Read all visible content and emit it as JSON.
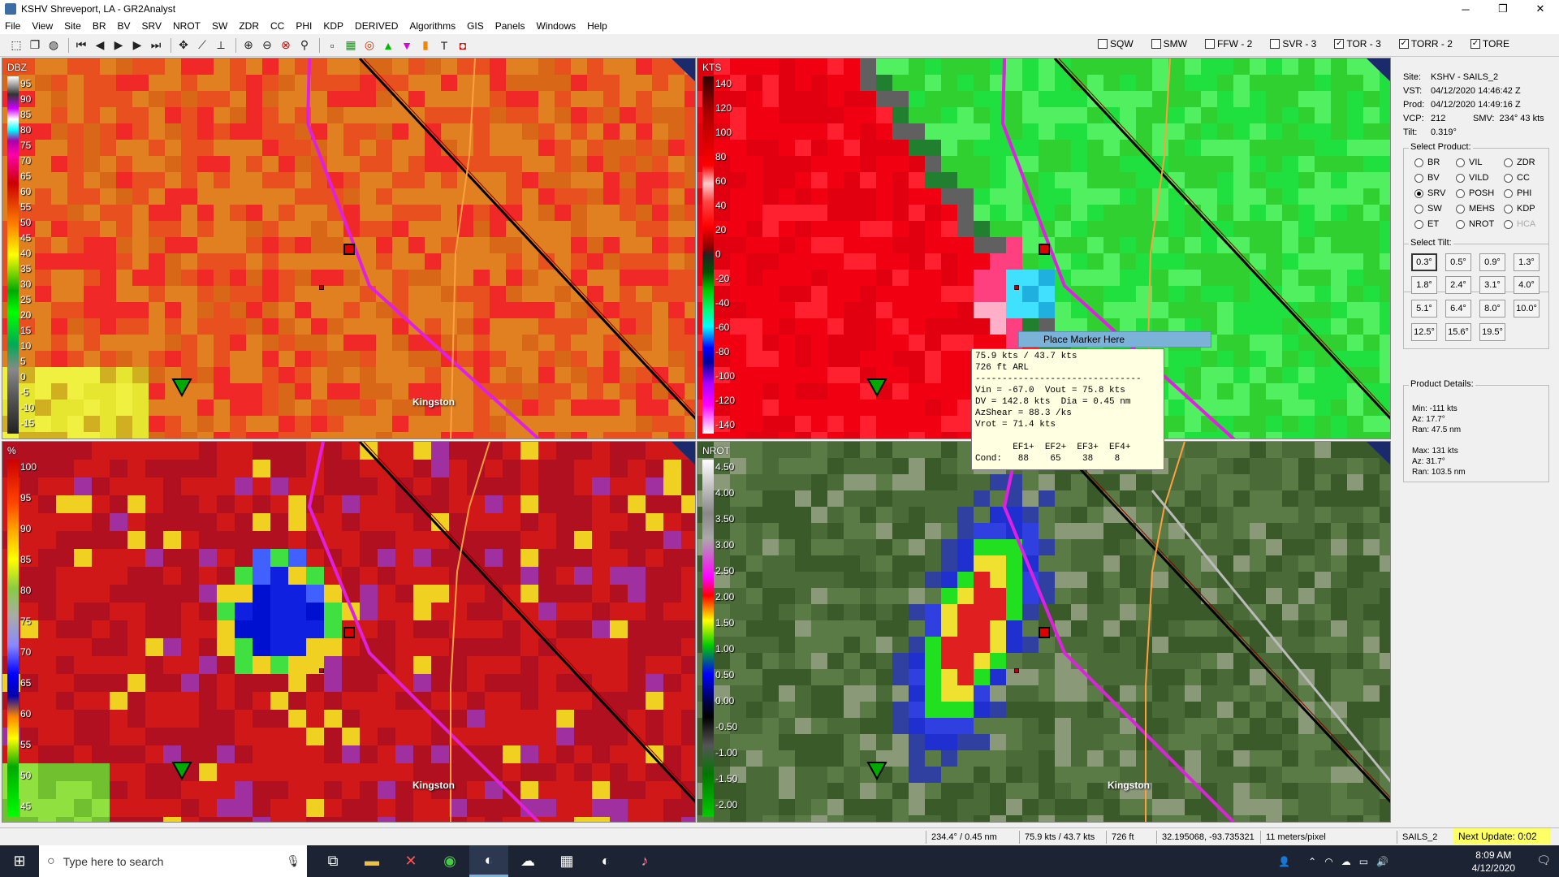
{
  "window": {
    "title": "KSHV Shreveport, LA - GR2Analyst",
    "min": "─",
    "max": "❐",
    "close": "✕"
  },
  "menu": [
    "File",
    "View",
    "Site",
    "BR",
    "BV",
    "SRV",
    "NROT",
    "SW",
    "ZDR",
    "CC",
    "PHI",
    "KDP",
    "DERIVED",
    "Algorithms",
    "GIS",
    "Panels",
    "Windows",
    "Help"
  ],
  "warnings": [
    {
      "label": "SQW",
      "checked": false
    },
    {
      "label": "SMW",
      "checked": false
    },
    {
      "label": "FFW - 2",
      "checked": false
    },
    {
      "label": "SVR - 3",
      "checked": false
    },
    {
      "label": "TOR - 3",
      "checked": true
    },
    {
      "label": "TORR - 2",
      "checked": true
    },
    {
      "label": "TORE",
      "checked": true
    }
  ],
  "panels": {
    "p1": {
      "unit": "DBZ",
      "ticks": [
        "95",
        "90",
        "85",
        "80",
        "75",
        "70",
        "65",
        "60",
        "55",
        "50",
        "45",
        "40",
        "35",
        "30",
        "25",
        "20",
        "15",
        "10",
        "5",
        "0",
        "-5",
        "-10",
        "-15"
      ],
      "town": "Kingston"
    },
    "p2": {
      "unit": "KTS",
      "ticks": [
        "140",
        "120",
        "100",
        "80",
        "60",
        "40",
        "20",
        "0",
        "-20",
        "-40",
        "-60",
        "-80",
        "-100",
        "-120",
        "-140"
      ],
      "town": "Kingston"
    },
    "p3": {
      "unit": "%",
      "ticks": [
        "100",
        "95",
        "90",
        "85",
        "80",
        "75",
        "70",
        "65",
        "60",
        "55",
        "50",
        "45"
      ],
      "town": "Kingston"
    },
    "p4": {
      "unit": "NROT",
      "ticks": [
        "4.50",
        "4.00",
        "3.50",
        "3.00",
        "2.50",
        "2.00",
        "1.50",
        "1.00",
        "0.50",
        "0.00",
        "-0.50",
        "-1.00",
        "-1.50",
        "-2.00"
      ],
      "town": "Kingston"
    }
  },
  "context_menu": {
    "label": "Place Marker Here"
  },
  "readout": {
    "line1": "75.9 kts / 43.7 kts",
    "line2": "726 ft ARL",
    "line3": "-------------------------------",
    "line4": "Vin = -67.0  Vout = 75.8 kts",
    "line5": "DV = 142.8 kts  Dia = 0.45 nm",
    "line6": "AzShear = 88.3 /ks",
    "line7": "Vrot = 71.4 kts",
    "line8": "",
    "line9": "       EF1+  EF2+  EF3+  EF4+",
    "line10": "Cond:   88    65    38    8"
  },
  "info": {
    "site_k": "Site:",
    "site_v": "KSHV - SAILS_2",
    "vst_k": "VST:",
    "vst_v": "04/12/2020  14:46:42 Z",
    "prod_k": "Prod:",
    "prod_v": "04/12/2020  14:49:16 Z",
    "vcp_k": "VCP:",
    "vcp_v": "212",
    "smv_k": "SMV:",
    "smv_v": "234° 43 kts",
    "tilt_k": "Tilt:",
    "tilt_v": "0.319°"
  },
  "select_product": {
    "label": "Select Product:",
    "options": [
      {
        "label": "BR",
        "selected": false,
        "disabled": false
      },
      {
        "label": "VIL",
        "selected": false,
        "disabled": false
      },
      {
        "label": "ZDR",
        "selected": false,
        "disabled": false
      },
      {
        "label": "BV",
        "selected": false,
        "disabled": false
      },
      {
        "label": "VILD",
        "selected": false,
        "disabled": false
      },
      {
        "label": "CC",
        "selected": false,
        "disabled": false
      },
      {
        "label": "SRV",
        "selected": true,
        "disabled": false
      },
      {
        "label": "POSH",
        "selected": false,
        "disabled": false
      },
      {
        "label": "PHI",
        "selected": false,
        "disabled": false
      },
      {
        "label": "SW",
        "selected": false,
        "disabled": false
      },
      {
        "label": "MEHS",
        "selected": false,
        "disabled": false
      },
      {
        "label": "KDP",
        "selected": false,
        "disabled": false
      },
      {
        "label": "ET",
        "selected": false,
        "disabled": false
      },
      {
        "label": "NROT",
        "selected": false,
        "disabled": false
      },
      {
        "label": "HCA",
        "selected": false,
        "disabled": true
      }
    ]
  },
  "select_tilt": {
    "label": "Select Tilt:",
    "options": [
      "0.3°",
      "0.5°",
      "0.9°",
      "1.3°",
      "1.8°",
      "2.4°",
      "3.1°",
      "4.0°",
      "5.1°",
      "6.4°",
      "8.0°",
      "10.0°",
      "12.5°",
      "15.6°",
      "19.5°"
    ],
    "selected": "0.3°"
  },
  "product_details": {
    "label": "Product Details:",
    "min": "Min:  -111 kts",
    "min_az": "Az:   17.7°",
    "min_ran": "Ran:  47.5 nm",
    "max": "Max:  131 kts",
    "max_az": "Az:   31.7°",
    "max_ran": "Ran:  103.5 nm"
  },
  "status": {
    "azran": "234.4° / 0.45 nm",
    "vel": "75.9 kts / 43.7 kts",
    "height": "726 ft",
    "latlon": "32.195068, -93.735321",
    "scale": "11 meters/pixel",
    "mode": "SAILS_2",
    "next": "Next Update: 0:02"
  },
  "taskbar": {
    "search_placeholder": "Type here to search",
    "time": "8:09 AM",
    "date": "4/12/2020"
  }
}
